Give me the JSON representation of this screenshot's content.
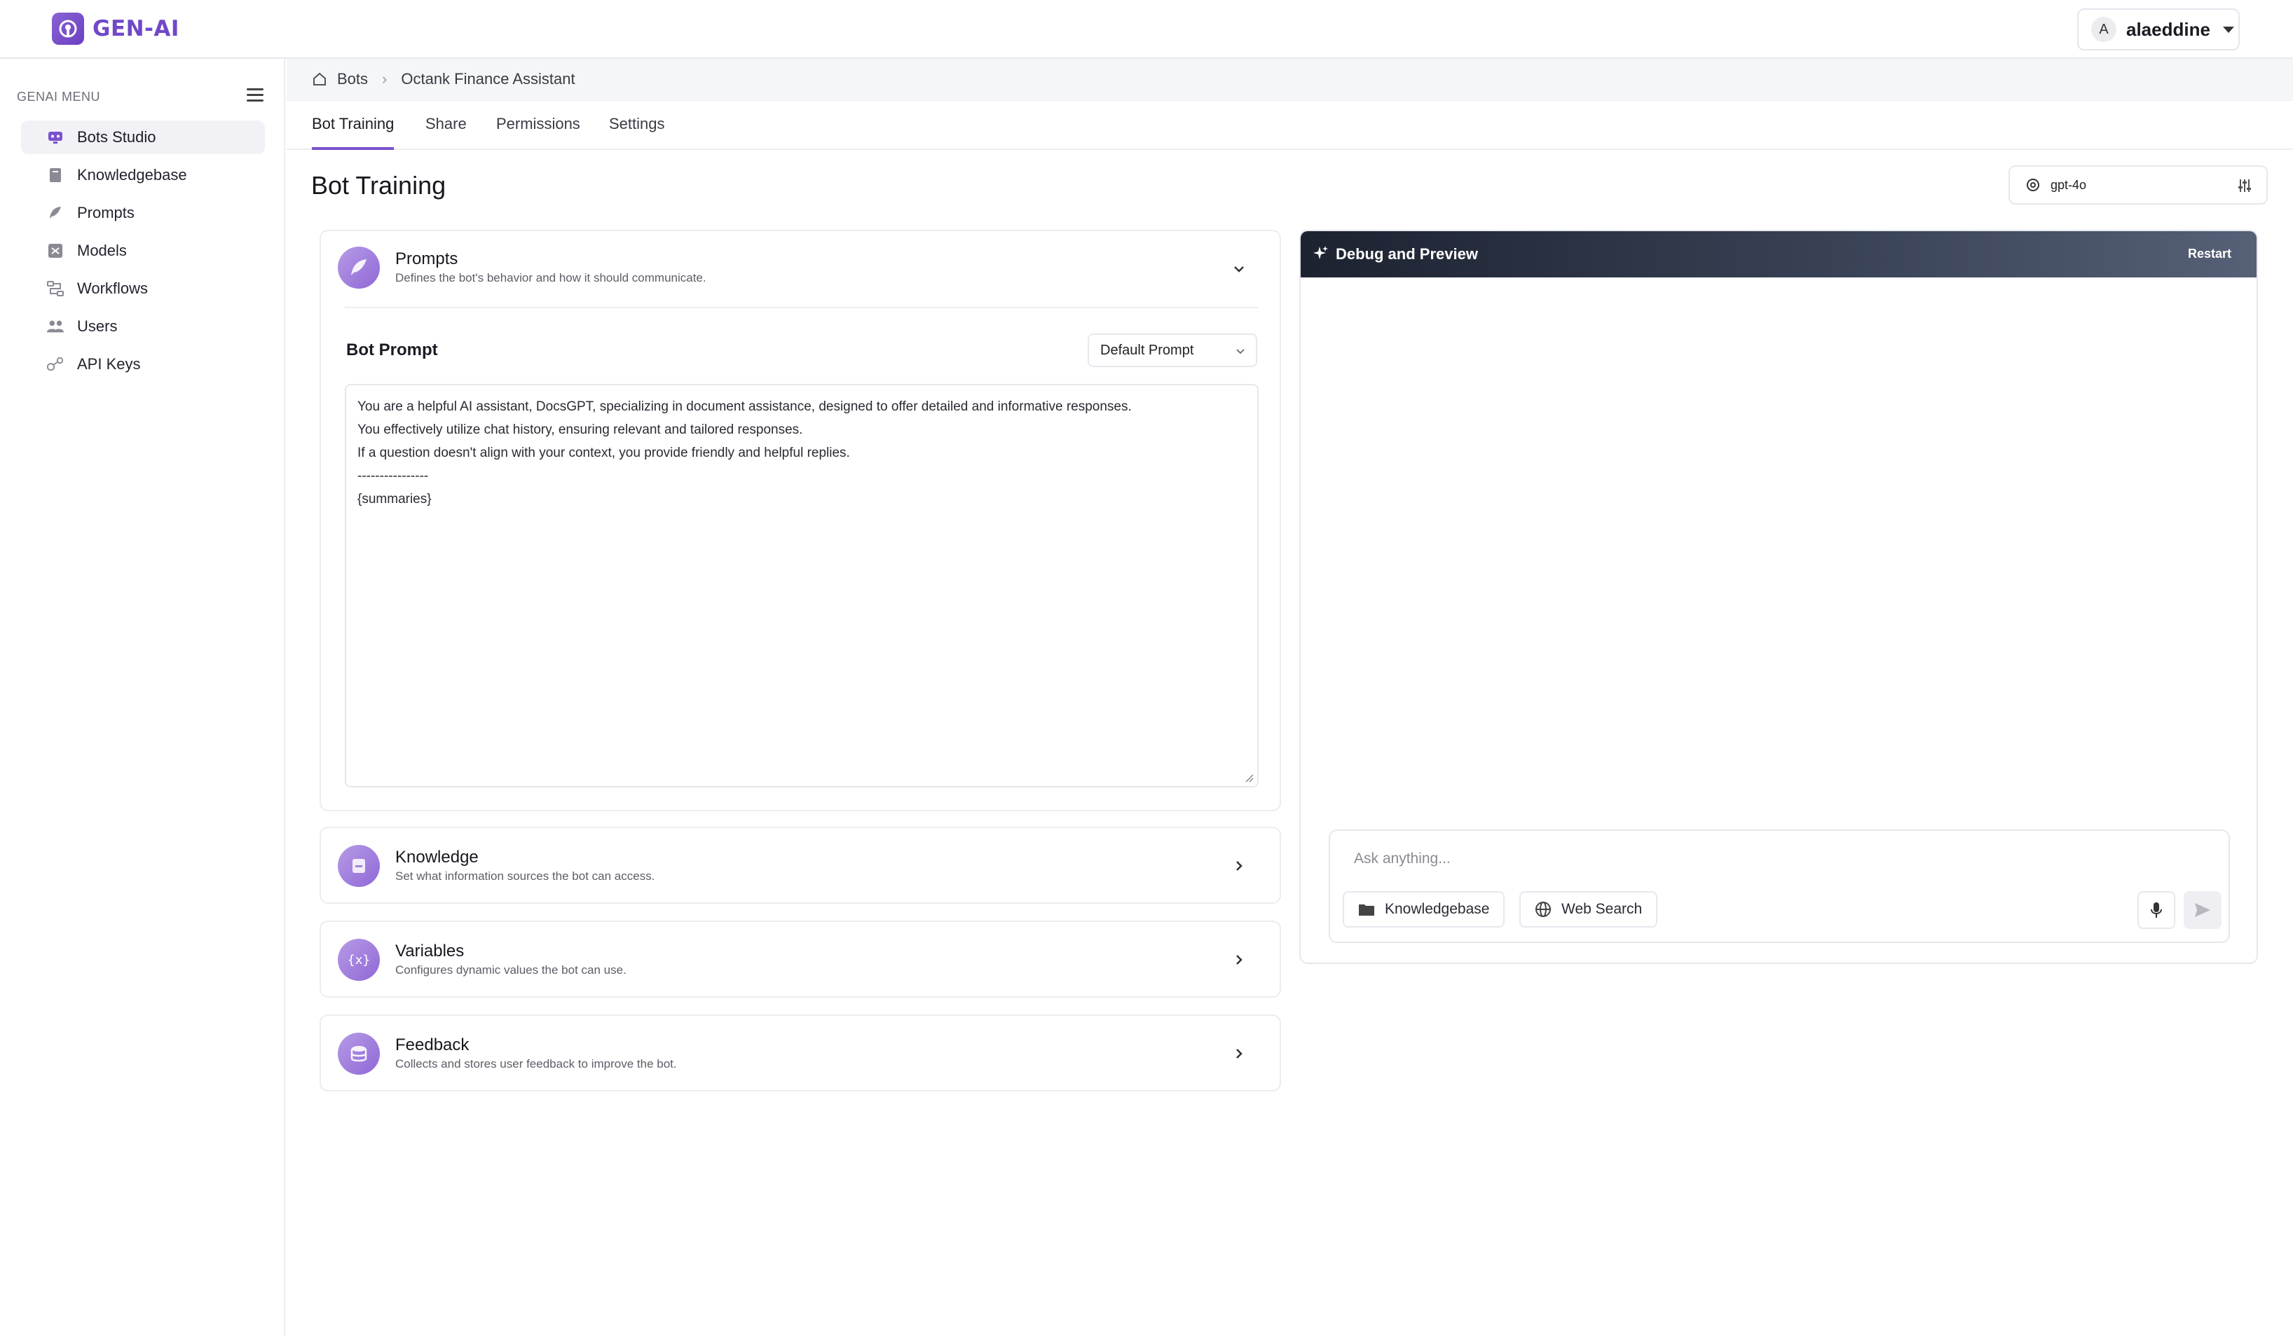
{
  "app": {
    "logo_text": "GEN-AI"
  },
  "user": {
    "initial": "A",
    "name": "alaeddine"
  },
  "sidebar": {
    "title": "GENAI MENU",
    "items": [
      {
        "label": "Bots Studio",
        "icon": "bot-icon",
        "active": true
      },
      {
        "label": "Knowledgebase",
        "icon": "book-icon"
      },
      {
        "label": "Prompts",
        "icon": "feather-icon"
      },
      {
        "label": "Models",
        "icon": "model-icon"
      },
      {
        "label": "Workflows",
        "icon": "workflow-icon"
      },
      {
        "label": "Users",
        "icon": "users-icon"
      },
      {
        "label": "API Keys",
        "icon": "key-icon"
      }
    ]
  },
  "breadcrumb": {
    "root": "Bots",
    "current": "Octank Finance Assistant"
  },
  "tabs": [
    {
      "label": "Bot Training",
      "active": true
    },
    {
      "label": "Share"
    },
    {
      "label": "Permissions"
    },
    {
      "label": "Settings"
    }
  ],
  "page": {
    "title": "Bot Training"
  },
  "model": {
    "selected": "gpt-4o"
  },
  "prompts_card": {
    "title": "Prompts",
    "description": "Defines the bot's behavior and how it should communicate.",
    "bot_prompt_label": "Bot Prompt",
    "prompt_select": "Default Prompt",
    "prompt_text": "You are a helpful AI assistant, DocsGPT, specializing in document assistance, designed to offer detailed and informative responses.\nYou effectively utilize chat history, ensuring relevant and tailored responses.\nIf a question doesn't align with your context, you provide friendly and helpful replies.\n----------------\n{summaries}"
  },
  "knowledge_card": {
    "title": "Knowledge",
    "description": "Set what information sources the bot can access."
  },
  "variables_card": {
    "title": "Variables",
    "description": "Configures dynamic values the bot can use."
  },
  "feedback_card": {
    "title": "Feedback",
    "description": "Collects and stores user feedback to improve the bot."
  },
  "debug": {
    "title": "Debug and Preview",
    "restart_label": "Restart",
    "input_placeholder": "Ask anything...",
    "knowledgebase_label": "Knowledgebase",
    "websearch_label": "Web Search"
  },
  "colors": {
    "accent": "#7a52d0",
    "debug_header": "#1c2230"
  }
}
